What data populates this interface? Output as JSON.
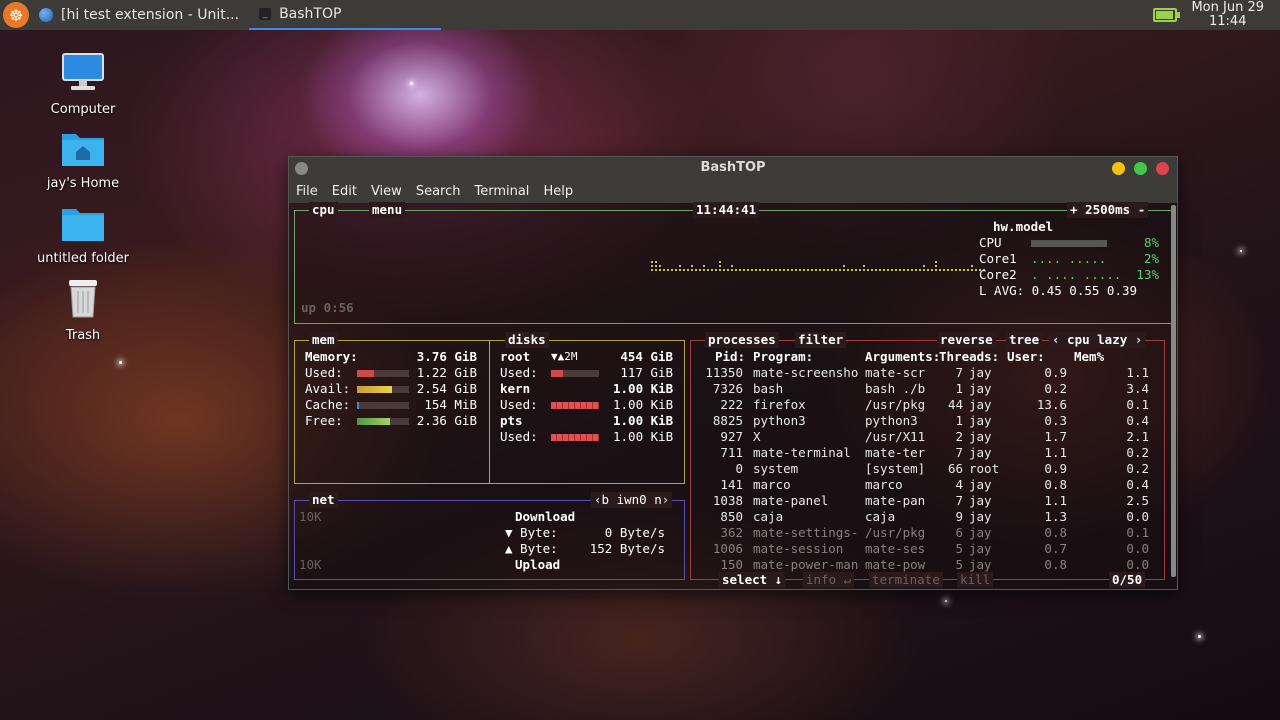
{
  "top_panel": {
    "tasks": [
      {
        "label": "[hi test extension - Unit..."
      },
      {
        "label": "BashTOP"
      }
    ],
    "clock": {
      "date": "Mon Jun 29",
      "time": "11:44"
    },
    "battery_level": 0.95
  },
  "desktop": {
    "icons": [
      {
        "label": "Computer",
        "icon": "monitor-icon"
      },
      {
        "label": "jay's Home",
        "icon": "home-folder-icon"
      },
      {
        "label": "untitled folder",
        "icon": "folder-icon"
      },
      {
        "label": "Trash",
        "icon": "trash-icon"
      }
    ]
  },
  "window": {
    "title": "BashTOP",
    "menu": [
      "File",
      "Edit",
      "View",
      "Search",
      "Terminal",
      "Help"
    ]
  },
  "cpu": {
    "label": "cpu",
    "menu": "menu",
    "time": "11:44:41",
    "update": "+ 2500ms -",
    "model": "hw.model",
    "rows": [
      {
        "name": "CPU",
        "pct": "8%",
        "value": 8
      },
      {
        "name": "Core1",
        "pct": "2%",
        "value": 2
      },
      {
        "name": "Core2",
        "pct": "13%",
        "value": 13
      }
    ],
    "load_avg": "L AVG: 0.45 0.55 0.39",
    "uptime": "up 0:56"
  },
  "mem": {
    "label": "mem",
    "rows": [
      {
        "name": "Memory:",
        "value": "3.76 GiB"
      },
      {
        "name": "Used:",
        "value": "1.22 GiB",
        "pct": 0.32
      },
      {
        "name": "Avail:",
        "value": "2.54 GiB",
        "pct": 0.68
      },
      {
        "name": "Cache:",
        "value": "154 MiB",
        "pct": 0.04
      },
      {
        "name": "Free:",
        "value": "2.36 GiB",
        "pct": 0.63
      }
    ]
  },
  "disks": {
    "label": "disks",
    "rows": [
      {
        "name": "root",
        "io": "▼▲2M",
        "value": "454 GiB"
      },
      {
        "name": "Used:",
        "value": "117 GiB",
        "pct": 0.26
      },
      {
        "name": "kern",
        "value": "1.00 KiB"
      },
      {
        "name": "Used:",
        "value": "1.00 KiB",
        "pct": 1.0
      },
      {
        "name": "pts",
        "value": "1.00 KiB"
      },
      {
        "name": "Used:",
        "value": "1.00 KiB",
        "pct": 1.0
      }
    ]
  },
  "net": {
    "label": "net",
    "iface": "‹b iwn0 n›",
    "scale_top": "10K",
    "scale_bottom": "10K",
    "download_label": "Download",
    "upload_label": "Upload",
    "down_byte": "▼ Byte:",
    "down_rate": "0 Byte/s",
    "up_byte": "▲ Byte:",
    "up_rate": "152 Byte/s"
  },
  "proc": {
    "label": "processes",
    "filter": "filter",
    "reverse": "reverse",
    "tree": "tree",
    "sort": "‹ cpu lazy ›",
    "headers": [
      "Pid:",
      "Program:",
      "Arguments:",
      "Threads:",
      "User:",
      "Mem%"
    ],
    "rows": [
      {
        "pid": "11350",
        "prog": "mate-screensho",
        "args": "mate-scr",
        "thr": "7",
        "user": "jay",
        "mem": "0.9",
        "cpu": "1.1"
      },
      {
        "pid": "7326",
        "prog": "bash",
        "args": "bash ./b",
        "thr": "1",
        "user": "jay",
        "mem": "0.2",
        "cpu": "3.4"
      },
      {
        "pid": "222",
        "prog": "firefox",
        "args": "/usr/pkg",
        "thr": "44",
        "user": "jay",
        "mem": "13.6",
        "cpu": "0.1"
      },
      {
        "pid": "8825",
        "prog": "python3",
        "args": "python3",
        "thr": "1",
        "user": "jay",
        "mem": "0.3",
        "cpu": "0.4"
      },
      {
        "pid": "927",
        "prog": "X",
        "args": "/usr/X11",
        "thr": "2",
        "user": "jay",
        "mem": "1.7",
        "cpu": "2.1"
      },
      {
        "pid": "711",
        "prog": "mate-terminal",
        "args": "mate-ter",
        "thr": "7",
        "user": "jay",
        "mem": "1.1",
        "cpu": "0.2"
      },
      {
        "pid": "0",
        "prog": "system",
        "args": "[system]",
        "thr": "66",
        "user": "root",
        "mem": "0.9",
        "cpu": "0.2"
      },
      {
        "pid": "141",
        "prog": "marco",
        "args": "marco",
        "thr": "4",
        "user": "jay",
        "mem": "0.8",
        "cpu": "0.4"
      },
      {
        "pid": "1038",
        "prog": "mate-panel",
        "args": "mate-pan",
        "thr": "7",
        "user": "jay",
        "mem": "1.1",
        "cpu": "2.5"
      },
      {
        "pid": "850",
        "prog": "caja",
        "args": "caja",
        "thr": "9",
        "user": "jay",
        "mem": "1.3",
        "cpu": "0.0"
      },
      {
        "pid": "362",
        "prog": "mate-settings-",
        "args": "/usr/pkg",
        "thr": "6",
        "user": "jay",
        "mem": "0.8",
        "cpu": "0.1"
      },
      {
        "pid": "1006",
        "prog": "mate-session",
        "args": "mate-ses",
        "thr": "5",
        "user": "jay",
        "mem": "0.7",
        "cpu": "0.0"
      },
      {
        "pid": "150",
        "prog": "mate-power-man",
        "args": "mate-pow",
        "thr": "5",
        "user": "jay",
        "mem": "0.8",
        "cpu": "0.0"
      }
    ],
    "footer": {
      "select": "select ↓",
      "info": "info ↵",
      "terminate": "terminate",
      "kill": "kill",
      "count": "0/50"
    }
  },
  "colors": {
    "cpu_border": "#6aa86a",
    "mem_border": "#b3a347",
    "net_border": "#5a4fb0",
    "proc_border": "#a13c3c",
    "graph": "#c7c45a",
    "green": "#5bd16b",
    "bar_red": "#d04848"
  }
}
